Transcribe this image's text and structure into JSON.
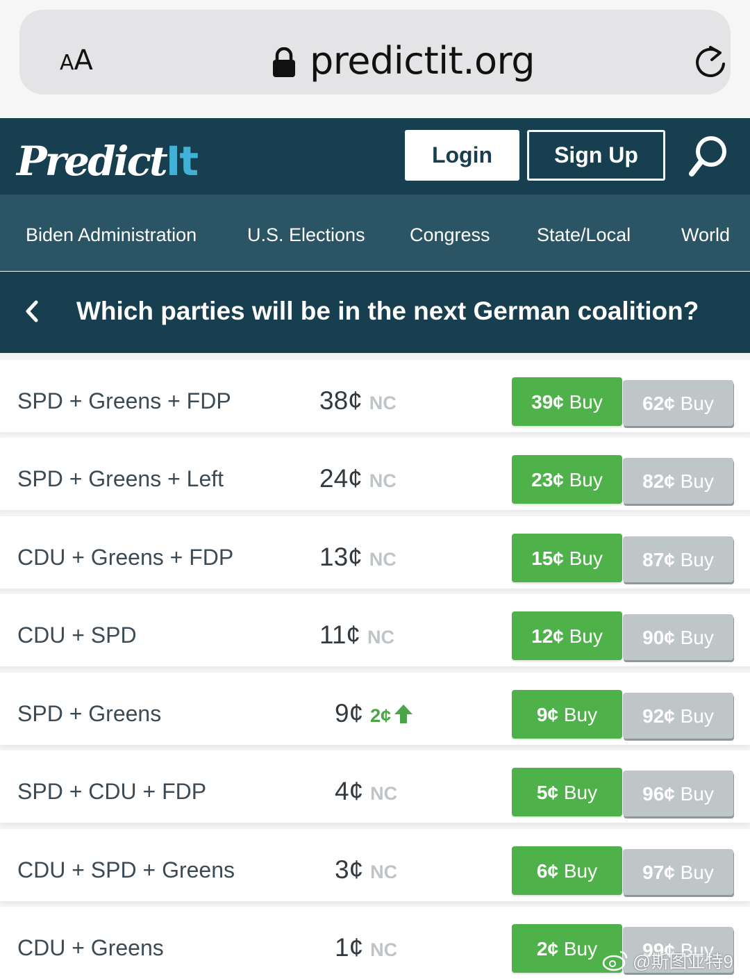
{
  "browser": {
    "text_size_label_small": "A",
    "text_size_label_big": "A",
    "url": "predictit.org",
    "icons": [
      "lock-icon",
      "reload-icon"
    ]
  },
  "header": {
    "logo_main": "Predict",
    "logo_accent": "It",
    "login_label": "Login",
    "signup_label": "Sign Up",
    "search_icon": "search-icon",
    "colors": {
      "header_bg": "#173f4f",
      "logo_accent": "#40b2d6"
    }
  },
  "nav": {
    "items": [
      "Biden Administration",
      "U.S. Elections",
      "Congress",
      "State/Local",
      "World"
    ],
    "bg": "#2b5564"
  },
  "market": {
    "title": "Which parties will be in the next German coalition?",
    "back_icon": "chevron-left-icon"
  },
  "contracts": [
    {
      "name": "SPD + Greens + FDP",
      "price": "38¢",
      "change": "NC",
      "yes_price": "39¢",
      "no_price": "62¢",
      "buy_label": "Buy"
    },
    {
      "name": "SPD + Greens + Left",
      "price": "24¢",
      "change": "NC",
      "yes_price": "23¢",
      "no_price": "82¢",
      "buy_label": "Buy"
    },
    {
      "name": "CDU + Greens + FDP",
      "price": "13¢",
      "change": "NC",
      "yes_price": "15¢",
      "no_price": "87¢",
      "buy_label": "Buy"
    },
    {
      "name": "CDU + SPD",
      "price": "11¢",
      "change": "NC",
      "yes_price": "12¢",
      "no_price": "90¢",
      "buy_label": "Buy"
    },
    {
      "name": "SPD + Greens",
      "price": "9¢",
      "change": "2¢",
      "change_direction": "up",
      "yes_price": "9¢",
      "no_price": "92¢",
      "buy_label": "Buy"
    },
    {
      "name": "SPD + CDU + FDP",
      "price": "4¢",
      "change": "NC",
      "yes_price": "5¢",
      "no_price": "96¢",
      "buy_label": "Buy"
    },
    {
      "name": "CDU + SPD + Greens",
      "price": "3¢",
      "change": "NC",
      "yes_price": "6¢",
      "no_price": "97¢",
      "buy_label": "Buy"
    },
    {
      "name": "CDU + Greens",
      "price": "1¢",
      "change": "NC",
      "yes_price": "2¢",
      "no_price": "99¢",
      "buy_label": "Buy"
    }
  ],
  "colors": {
    "buy_yes": "#4fb14a",
    "buy_no": "#bfc6c8",
    "change_up": "#4aa546",
    "change_nc": "#bfc4c7"
  },
  "watermark": {
    "text": "@斯图亚特9",
    "icon": "weibo-icon"
  }
}
